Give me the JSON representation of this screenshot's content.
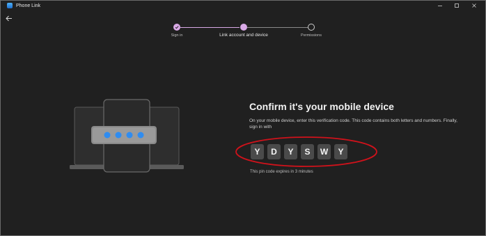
{
  "window": {
    "app_title": "Phone Link",
    "controls": [
      "minimize-icon",
      "maximize-icon",
      "close-icon"
    ]
  },
  "nav": {
    "back_icon": "back-arrow-icon"
  },
  "stepper": {
    "steps": [
      {
        "label": "Sign in",
        "state": "completed"
      },
      {
        "label": "Link account and device",
        "state": "current"
      },
      {
        "label": "Permissions",
        "state": "upcoming"
      }
    ],
    "accent": "#d9a9e6"
  },
  "main": {
    "heading": "Confirm it's your mobile device",
    "description": "On your mobile device, enter this verification code. This code contains both letters and numbers. Finally, sign in with",
    "code": [
      "Y",
      "D",
      "Y",
      "S",
      "W",
      "Y"
    ],
    "expiry": "This pin code expires in 3 minutes"
  },
  "illustration": {
    "icon": "devices-pin-illustration",
    "pin_dot_count": 4,
    "pin_dot_color": "#2f8cf0"
  },
  "annotation": {
    "color": "#d0121b",
    "shape": "ellipse"
  }
}
